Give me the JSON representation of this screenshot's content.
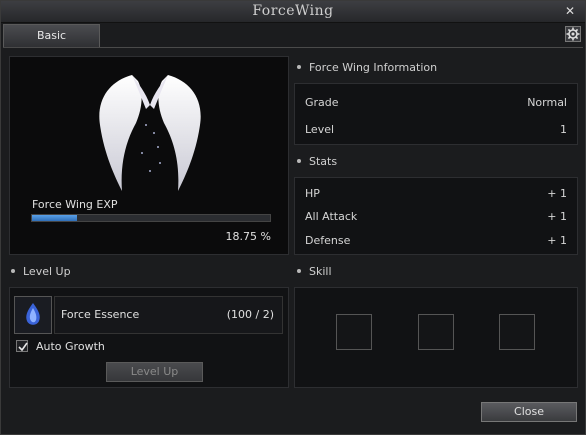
{
  "window": {
    "title": "ForceWing"
  },
  "tabs": [
    {
      "label": "Basic"
    }
  ],
  "wing": {
    "exp_label": "Force Wing EXP",
    "exp_percent_text": "18.75 %",
    "exp_fraction": 0.1875
  },
  "info": {
    "heading": "Force Wing Information",
    "rows": [
      {
        "key": "Grade",
        "value": "Normal"
      },
      {
        "key": "Level",
        "value": "1"
      }
    ]
  },
  "stats": {
    "heading": "Stats",
    "rows": [
      {
        "key": "HP",
        "value": "+ 1"
      },
      {
        "key": "All Attack",
        "value": "+ 1"
      },
      {
        "key": "Defense",
        "value": "+ 1"
      }
    ]
  },
  "levelup": {
    "heading": "Level Up",
    "item_name": "Force Essence",
    "item_count": "(100 / 2)",
    "auto_growth_label": "Auto Growth",
    "auto_growth_checked": true,
    "button_label": "Level Up"
  },
  "skill": {
    "heading": "Skill"
  },
  "footer": {
    "close_label": "Close"
  }
}
